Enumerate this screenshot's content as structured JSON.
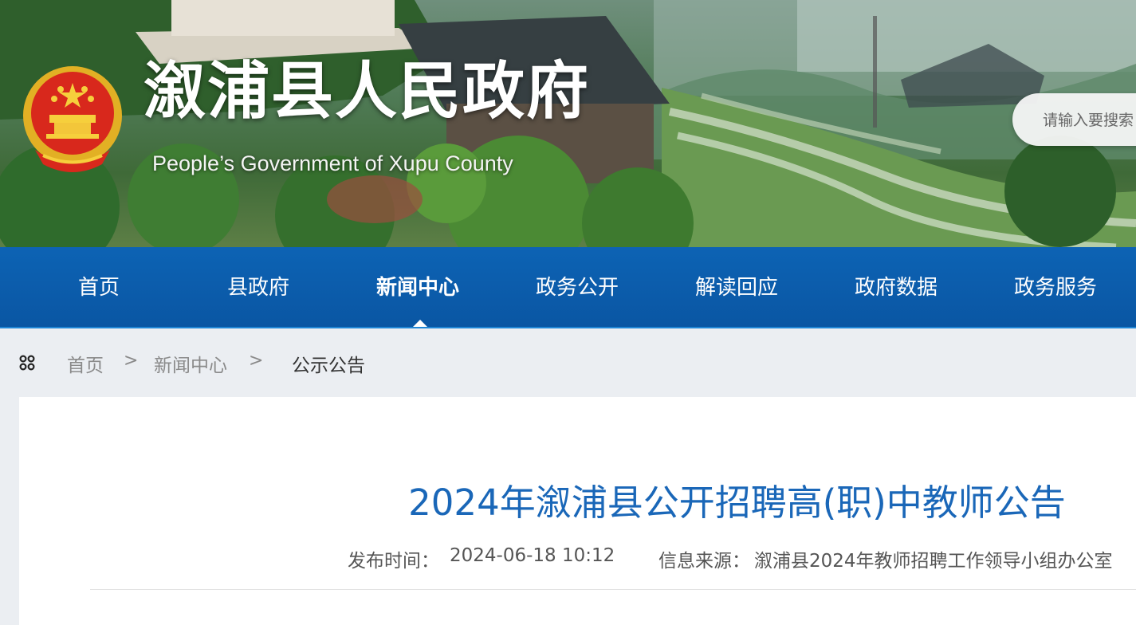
{
  "header": {
    "site_title": "溆浦县人民政府",
    "site_subtitle": "People’s Government of Xupu County",
    "search_placeholder": "请输入要搜索"
  },
  "nav": {
    "items": [
      {
        "label": "首页"
      },
      {
        "label": "县政府"
      },
      {
        "label": "新闻中心"
      },
      {
        "label": "政务公开"
      },
      {
        "label": "解读回应"
      },
      {
        "label": "政府数据"
      },
      {
        "label": "政务服务"
      }
    ],
    "active_index": 2
  },
  "breadcrumb": {
    "items": [
      "首页",
      "新闻中心",
      "公示公告"
    ],
    "separator": ">"
  },
  "article": {
    "title": "2024年溆浦县公开招聘高(职)中教师公告",
    "publish_label": "发布时间：",
    "publish_time": "2024-06-18 10:12",
    "source_label": "信息来源：",
    "source": "溆浦县2024年教师招聘工作领导小组办公室"
  },
  "colors": {
    "nav_bg": "#0a5aa8",
    "title_blue": "#1a67b8",
    "page_bg": "#ebeef2"
  }
}
